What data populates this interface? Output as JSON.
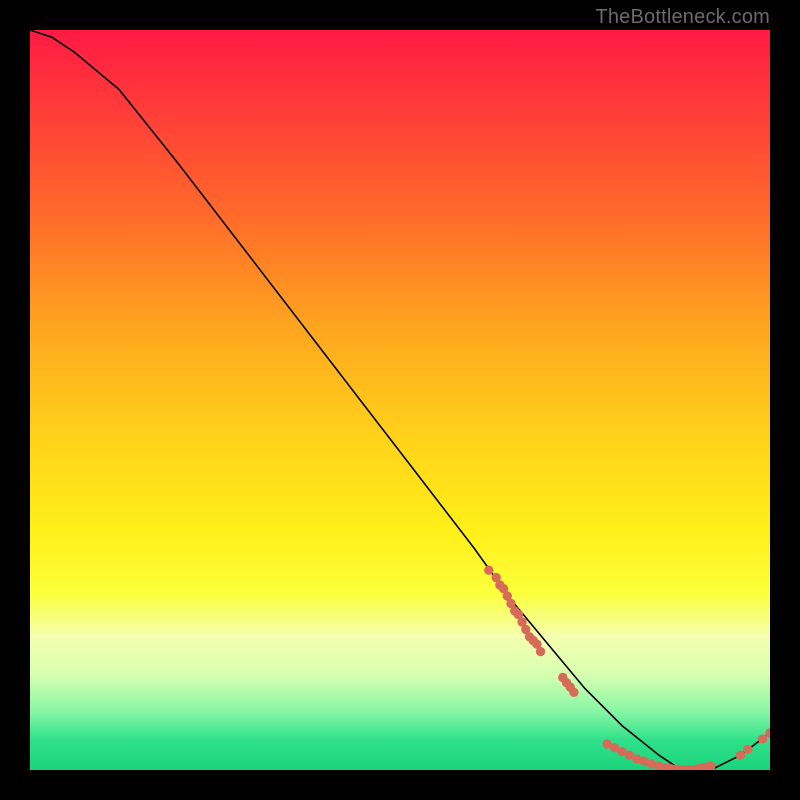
{
  "watermark": "TheBottleneck.com",
  "chart_data": {
    "type": "line",
    "title": "",
    "xlabel": "",
    "ylabel": "",
    "xlim": [
      0,
      100
    ],
    "ylim": [
      0,
      100
    ],
    "grid": false,
    "gradient_stops": [
      {
        "pos": 0,
        "color": "#ff1a44"
      },
      {
        "pos": 10,
        "color": "#ff3a3a"
      },
      {
        "pos": 25,
        "color": "#ff6a2a"
      },
      {
        "pos": 40,
        "color": "#ffa51f"
      },
      {
        "pos": 55,
        "color": "#ffd21a"
      },
      {
        "pos": 68,
        "color": "#fff01a"
      },
      {
        "pos": 76,
        "color": "#fbff3a"
      },
      {
        "pos": 82,
        "color": "#f5ffb0"
      },
      {
        "pos": 87,
        "color": "#d8ffb0"
      },
      {
        "pos": 92,
        "color": "#88f7a5"
      },
      {
        "pos": 96,
        "color": "#2fe08a"
      },
      {
        "pos": 100,
        "color": "#1ad47a"
      }
    ],
    "series": [
      {
        "name": "bottleneck-curve",
        "x": [
          0,
          3,
          6,
          9,
          12,
          20,
          30,
          40,
          50,
          60,
          65,
          70,
          75,
          80,
          85,
          88,
          92,
          96,
          100
        ],
        "y": [
          100,
          99,
          97,
          94.5,
          92,
          82,
          69,
          56,
          43,
          30,
          23,
          17,
          11,
          6,
          2,
          0,
          0,
          2,
          5
        ]
      }
    ],
    "dot_clusters": [
      {
        "name": "upper-left-cluster",
        "points_xy": [
          [
            62,
            27
          ],
          [
            63,
            26
          ],
          [
            63.5,
            25
          ],
          [
            64,
            24.5
          ],
          [
            64.5,
            23.5
          ],
          [
            65,
            22.5
          ],
          [
            65.5,
            21.5
          ],
          [
            66,
            21
          ],
          [
            66.5,
            20
          ],
          [
            67,
            19
          ],
          [
            67.5,
            18
          ],
          [
            68,
            17.5
          ],
          [
            68.5,
            17
          ],
          [
            69,
            16
          ]
        ]
      },
      {
        "name": "mid-gap-cluster",
        "points_xy": [
          [
            72,
            12.5
          ],
          [
            72.5,
            11.8
          ],
          [
            73,
            11.2
          ],
          [
            73.5,
            10.5
          ]
        ]
      },
      {
        "name": "bottom-flat-cluster",
        "points_xy": [
          [
            78,
            3.5
          ],
          [
            79,
            3
          ],
          [
            80,
            2.5
          ],
          [
            81,
            2
          ],
          [
            82,
            1.5
          ],
          [
            83,
            1.2
          ],
          [
            84,
            0.8
          ],
          [
            85,
            0.5
          ],
          [
            86,
            0.3
          ],
          [
            86.5,
            0.2
          ],
          [
            87,
            0.1
          ],
          [
            87.5,
            0.1
          ],
          [
            88,
            0
          ],
          [
            88.5,
            0
          ],
          [
            89,
            0
          ],
          [
            89.5,
            0
          ],
          [
            90,
            0.1
          ],
          [
            90.5,
            0.2
          ],
          [
            91,
            0.3
          ],
          [
            91.5,
            0.4
          ],
          [
            92,
            0.5
          ]
        ]
      },
      {
        "name": "right-rise-cluster",
        "points_xy": [
          [
            96,
            2
          ],
          [
            97,
            2.8
          ],
          [
            99,
            4.2
          ],
          [
            100,
            5
          ]
        ]
      }
    ]
  }
}
